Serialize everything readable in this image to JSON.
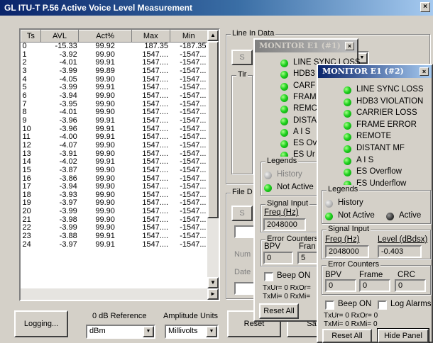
{
  "window": {
    "title": "GL ITU-T P.56 Active Voice Level Measurement",
    "close": "×"
  },
  "table": {
    "columns": [
      "Ts",
      "AVL",
      "Act%",
      "Max",
      "Min"
    ],
    "rows": [
      [
        "0",
        "-15.33",
        "99.92",
        "187.35",
        "-187.35"
      ],
      [
        "1",
        "-3.92",
        "99.90",
        "1547....",
        "-1547..."
      ],
      [
        "2",
        "-4.01",
        "99.91",
        "1547....",
        "-1547..."
      ],
      [
        "3",
        "-3.99",
        "99.89",
        "1547....",
        "-1547..."
      ],
      [
        "4",
        "-4.05",
        "99.90",
        "1547....",
        "-1547..."
      ],
      [
        "5",
        "-3.99",
        "99.91",
        "1547....",
        "-1547..."
      ],
      [
        "6",
        "-3.94",
        "99.90",
        "1547....",
        "-1547..."
      ],
      [
        "7",
        "-3.95",
        "99.90",
        "1547....",
        "-1547..."
      ],
      [
        "8",
        "-4.01",
        "99.90",
        "1547....",
        "-1547..."
      ],
      [
        "9",
        "-3.96",
        "99.91",
        "1547....",
        "-1547..."
      ],
      [
        "10",
        "-3.96",
        "99.91",
        "1547....",
        "-1547..."
      ],
      [
        "11",
        "-4.00",
        "99.91",
        "1547....",
        "-1547..."
      ],
      [
        "12",
        "-4.07",
        "99.90",
        "1547....",
        "-1547..."
      ],
      [
        "13",
        "-3.91",
        "99.90",
        "1547....",
        "-1547..."
      ],
      [
        "14",
        "-4.02",
        "99.91",
        "1547....",
        "-1547..."
      ],
      [
        "15",
        "-3.87",
        "99.90",
        "1547....",
        "-1547..."
      ],
      [
        "16",
        "-3.86",
        "99.90",
        "1547....",
        "-1547..."
      ],
      [
        "17",
        "-3.94",
        "99.90",
        "1547....",
        "-1547..."
      ],
      [
        "18",
        "-3.93",
        "99.90",
        "1547....",
        "-1547..."
      ],
      [
        "19",
        "-3.97",
        "99.90",
        "1547....",
        "-1547..."
      ],
      [
        "20",
        "-3.99",
        "99.90",
        "1547....",
        "-1547..."
      ],
      [
        "21",
        "-3.98",
        "99.90",
        "1547....",
        "-1547..."
      ],
      [
        "22",
        "-3.99",
        "99.90",
        "1547....",
        "-1547..."
      ],
      [
        "23",
        "-3.88",
        "99.91",
        "1547....",
        "-1547..."
      ],
      [
        "24",
        "-3.97",
        "99.91",
        "1547....",
        "-1547..."
      ]
    ]
  },
  "bottom": {
    "logging": "Logging...",
    "zero_db_label": "0 dB Reference",
    "zero_db_value": "dBm",
    "amp_units_label": "Amplitude Units",
    "amp_units_value": "Millivolts",
    "reset": "Reset",
    "sa": "Sa"
  },
  "main": {
    "line_in_data": "Line In Data",
    "tir": "Tir",
    "file_d": "File D",
    "s1": "S",
    "num": "Num",
    "date": "Date"
  },
  "monitor1": {
    "title": "MONITOR E1 (#1)",
    "close": "×",
    "statuses": [
      "LINE SYNC LOSS",
      "HDB3",
      "CARF",
      "FRAM",
      "REMC",
      "DISTA",
      "A I S",
      "ES Ov",
      "ES Ur"
    ],
    "legends_label": "Legends",
    "history": "History",
    "not_active": "Not Active",
    "signal_input": "Signal Input",
    "freq_label": "Freq (Hz)",
    "freq_value": "2048000",
    "error_counters": "Error Counters",
    "bpv": "BPV",
    "frame": "Fran",
    "bpv_value": "0",
    "frame_value": "5",
    "beep_on": "Beep ON",
    "txur": "TxUr= 0 RxOr=",
    "txmi": "TxMi= 0 RxMi=",
    "reset_all": "Reset All"
  },
  "monitor2": {
    "title": "MONITOR E1 (#2)",
    "close": "×",
    "statuses": [
      "LINE SYNC LOSS",
      "HDB3 VIOLATION",
      "CARRIER LOSS",
      "FRAME ERROR",
      "REMOTE",
      "DISTANT MF",
      "A I S",
      "ES Overflow",
      "ES Underflow"
    ],
    "legends_label": "Legends",
    "history": "History",
    "not_active": "Not Active",
    "active": "Active",
    "signal_input": "Signal Input",
    "freq_label": "Freq (Hz)",
    "level_label": "Level (dBdsx)",
    "freq_value": "2048000",
    "level_value": "-0.403",
    "error_counters": "Error Counters",
    "bpv": "BPV",
    "frame": "Frame",
    "crc": "CRC",
    "bpv_value": "0",
    "frame_value": "0",
    "crc_value": "0",
    "beep_on": "Beep ON",
    "log_alarms": "Log Alarms",
    "txur": "TxUr= 0 RxOr= 0",
    "txmi": "TxMi= 0 RxMi= 0",
    "reset_all": "Reset All",
    "hide_panel": "Hide Panel"
  }
}
